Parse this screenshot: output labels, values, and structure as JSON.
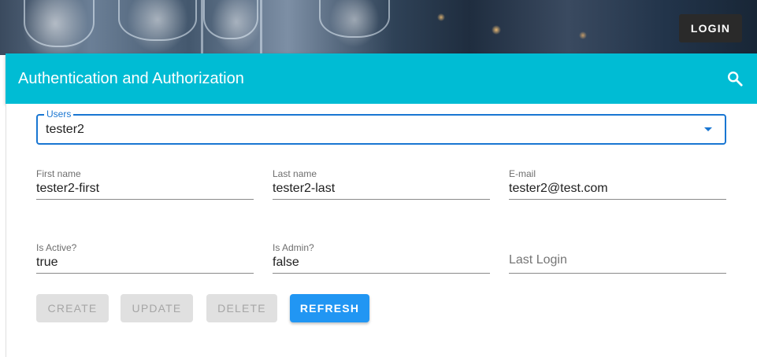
{
  "header": {
    "login_label": "LOGIN"
  },
  "app_bar": {
    "title": "Authentication and Authorization",
    "background_color": "#00bcd4",
    "search_icon": "search-icon"
  },
  "users_select": {
    "label": "Users",
    "selected": "tester2",
    "accent_color": "#1976d2"
  },
  "fields": {
    "first_name": {
      "label": "First name",
      "value": "tester2-first"
    },
    "last_name": {
      "label": "Last name",
      "value": "tester2-last"
    },
    "email": {
      "label": "E-mail",
      "value": "tester2@test.com"
    },
    "is_active": {
      "label": "Is Active?",
      "value": "true"
    },
    "is_admin": {
      "label": "Is Admin?",
      "value": "false"
    },
    "last_login": {
      "placeholder": "Last Login",
      "value": ""
    }
  },
  "actions": {
    "create": "CREATE",
    "update": "UPDATE",
    "delete": "DELETE",
    "refresh": "REFRESH",
    "primary_color": "#2196f3"
  }
}
